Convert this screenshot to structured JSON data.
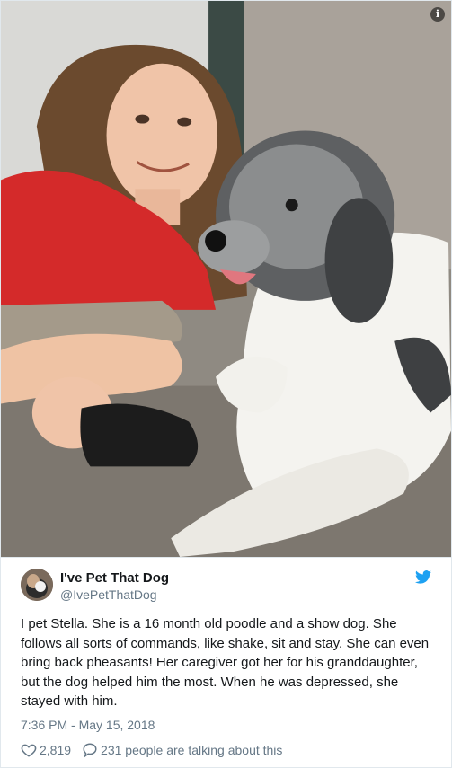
{
  "photo": {
    "alt_subject": "girl-with-poodle",
    "info_icon": "info-icon",
    "info_glyph": "i"
  },
  "tweet": {
    "display_name": "I've Pet That Dog",
    "handle": "@IvePetThatDog",
    "text": "I pet Stella. She is a 16 month old poodle and a show dog. She follows all sorts of commands, like shake, sit and stay. She can even bring back pheasants! Her caregiver got her for his granddaughter, but the dog helped him the most. When he was depressed, she stayed with him.",
    "timestamp": "7:36 PM - May 15, 2018",
    "likes": "2,819",
    "talking": "231 people are talking about this",
    "brand_color": "#1da1f2",
    "icons": {
      "brand": "twitter-bird-icon",
      "like": "heart-icon",
      "reply": "speech-bubble-icon"
    }
  }
}
